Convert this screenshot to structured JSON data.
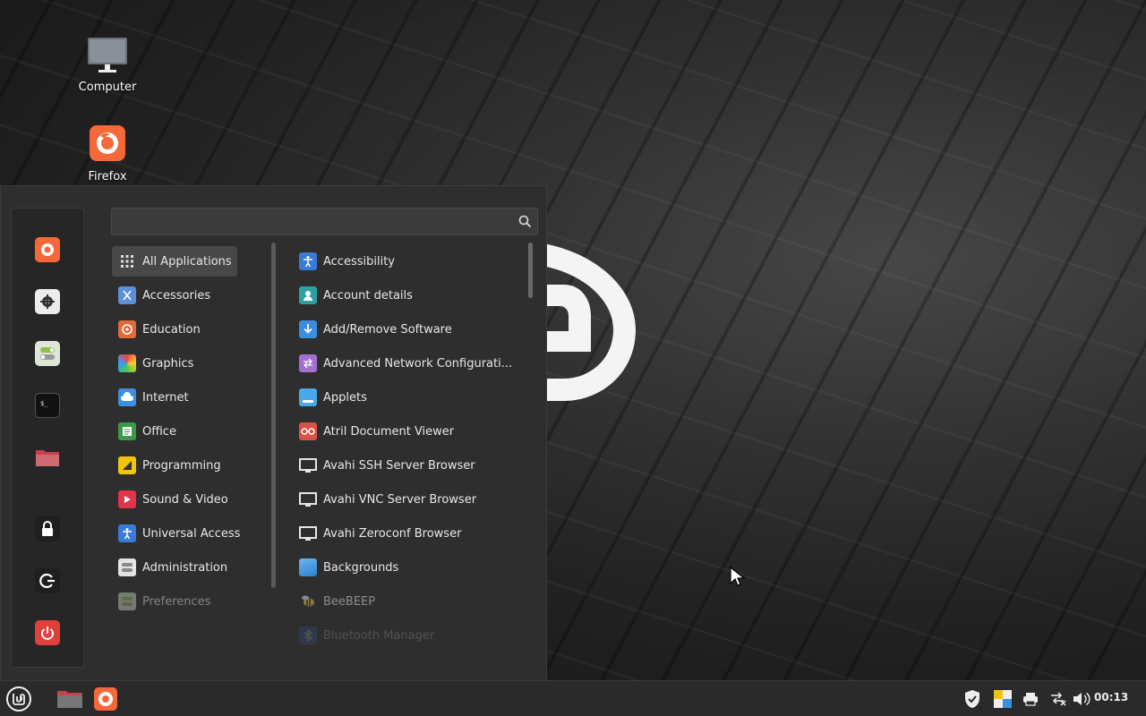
{
  "desktop": {
    "icons": [
      {
        "label": "Computer",
        "icon": "monitor-icon"
      },
      {
        "label": "Firefox",
        "icon": "firefox-icon"
      }
    ]
  },
  "menu": {
    "search": {
      "value": "",
      "placeholder": ""
    },
    "favorites": [
      {
        "name": "Firefox",
        "icon": "firefox-icon",
        "color": "#f4683a"
      },
      {
        "name": "Settings",
        "icon": "gear-icon",
        "color": "#e8e8e8"
      },
      {
        "name": "Toggles",
        "icon": "toggles-icon",
        "color": "#dfe6d8"
      },
      {
        "name": "Terminal",
        "icon": "terminal-icon",
        "color": "#111111"
      },
      {
        "name": "Files",
        "icon": "folder-icon",
        "color": "#c8404d"
      }
    ],
    "session": [
      {
        "name": "Lock Screen",
        "icon": "lock-icon"
      },
      {
        "name": "Logout",
        "icon": "logout-icon"
      },
      {
        "name": "Quit",
        "icon": "power-icon",
        "color": "#e0403a"
      }
    ],
    "categories": [
      {
        "label": "All Applications",
        "icon": "grid-icon"
      },
      {
        "label": "Accessories",
        "icon": "accessories-icon"
      },
      {
        "label": "Education",
        "icon": "education-icon"
      },
      {
        "label": "Graphics",
        "icon": "graphics-icon"
      },
      {
        "label": "Internet",
        "icon": "cloud-icon"
      },
      {
        "label": "Office",
        "icon": "office-icon"
      },
      {
        "label": "Programming",
        "icon": "programming-icon"
      },
      {
        "label": "Sound & Video",
        "icon": "play-icon"
      },
      {
        "label": "Universal Access",
        "icon": "accessibility-icon"
      },
      {
        "label": "Administration",
        "icon": "admin-icon"
      },
      {
        "label": "Preferences",
        "icon": "prefs-icon"
      }
    ],
    "applications": [
      {
        "label": "Accessibility",
        "icon": "accessibility-icon"
      },
      {
        "label": "Account details",
        "icon": "user-icon"
      },
      {
        "label": "Add/Remove Software",
        "icon": "download-icon"
      },
      {
        "label": "Advanced Network Configurati...",
        "icon": "network-icon"
      },
      {
        "label": "Applets",
        "icon": "applets-icon"
      },
      {
        "label": "Atril Document Viewer",
        "icon": "glasses-icon"
      },
      {
        "label": "Avahi SSH Server Browser",
        "icon": "monitor-icon"
      },
      {
        "label": "Avahi VNC Server Browser",
        "icon": "monitor-icon"
      },
      {
        "label": "Avahi Zeroconf Browser",
        "icon": "monitor-icon"
      },
      {
        "label": "Backgrounds",
        "icon": "backgrounds-icon"
      },
      {
        "label": "BeeBEEP",
        "icon": "bee-icon"
      },
      {
        "label": "Bluetooth Manager",
        "icon": "bluetooth-icon"
      }
    ]
  },
  "panel": {
    "clock": "00:13",
    "accent": "#f4683a"
  }
}
